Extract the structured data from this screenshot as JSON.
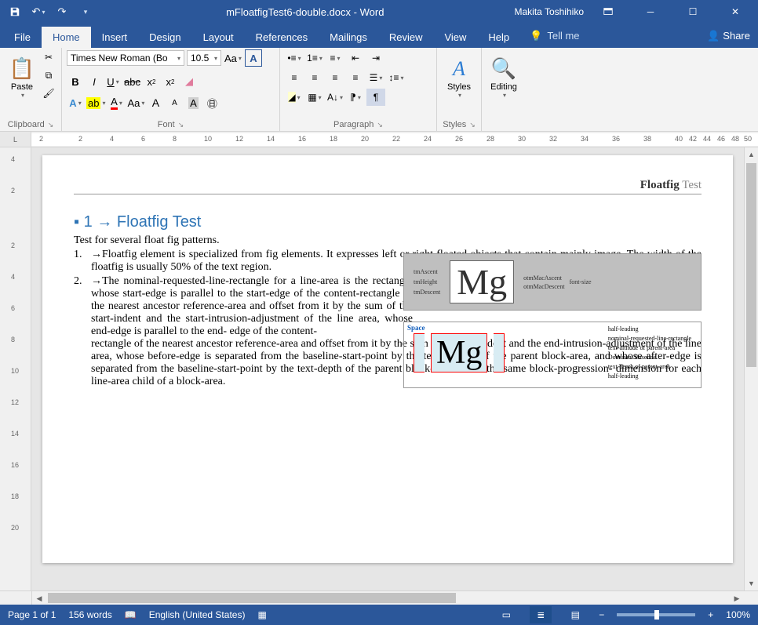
{
  "title": {
    "filename": "mFloatfigTest6-double.docx",
    "app": "Word",
    "user": "Makita Toshihiko"
  },
  "tabs": {
    "file": "File",
    "home": "Home",
    "insert": "Insert",
    "design": "Design",
    "layout": "Layout",
    "references": "References",
    "mailings": "Mailings",
    "review": "Review",
    "view": "View",
    "help": "Help",
    "tellme": "Tell me",
    "share": "Share"
  },
  "ribbon": {
    "clipboard": {
      "label": "Clipboard",
      "paste": "Paste"
    },
    "font": {
      "label": "Font",
      "family": "Times New Roman (Bo",
      "size": "10.5"
    },
    "paragraph": {
      "label": "Paragraph"
    },
    "styles": {
      "label": "Styles",
      "btn": "Styles"
    },
    "editing": {
      "label": "",
      "btn": "Editing"
    }
  },
  "doc": {
    "header": {
      "bold": "Floatfig",
      "rest": " Test"
    },
    "h1_num": "1",
    "h1": "Floatfig Test",
    "intro": "Test for several float fig patterns.",
    "item1_num": "1.",
    "item1": "Floatfig element is specialized from fig elements. It expresses left or right floated objects that contain mainly image. The width of the floatfig is usually 50% of the text region.",
    "item2_num": "2.",
    "item2a": "The nominal-requested-line-rectangle for a line-area is the rectangle whose start-edge is parallel to the start-edge of the content-rectangle of the nearest ancestor reference-area and offset from it by the sum of the start-indent and the start-intrusion-adjustment of the line area, whose end-edge is parallel to the end- edge of the content-",
    "item2b": "rectangle of the nearest ancestor reference-area and offset from it by the sum of the end-indent and the end-intrusion-adjustment of the line area, whose before-edge is separated from the baseline-start-point by the text-altitude of the parent block-area, and whose after-edge is separated from the baseline-start-point by the text-depth of the parent block-area. It has the same block-progression- dimension for each line-area child of a block-area.",
    "fig1": {
      "mg": "Mg",
      "l1": "tmAscent",
      "l2": "tmHeight",
      "l3": "tmDescent",
      "r1": "otmMacAscent",
      "r2": "otmMacDescent",
      "r3": "font-size"
    },
    "fig2": {
      "space": "Space",
      "mg": "Mg",
      "r1": "half-leading",
      "r2": "nominal-requested-line-rectangle",
      "r3": "text-altitude of parent-area",
      "r4": "Dominant Baseline",
      "r5": "text-depth of parent-area",
      "r6": "half-leading"
    }
  },
  "status": {
    "page": "Page 1 of 1",
    "words": "156 words",
    "lang": "English (United States)",
    "zoom": "100%"
  }
}
